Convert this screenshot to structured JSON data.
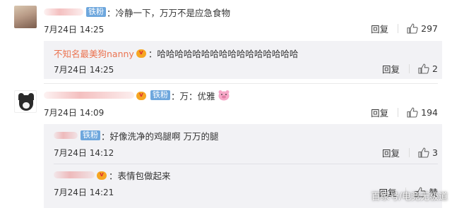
{
  "comments": [
    {
      "badge": "铁粉",
      "text": "冷静一下，万万不是应急食物",
      "time": "7月24日 14:25",
      "reply_label": "回复",
      "likes": "297",
      "replies": [
        {
          "username": "不知名最美狗nanny",
          "text": "哈哈哈哈哈哈哈哈哈哈哈哈哈哈哈哈",
          "time": "7月24日 14:25",
          "reply_label": "回复",
          "likes": "2"
        }
      ]
    },
    {
      "badge": "铁粉",
      "text": "万：优雅",
      "time": "7月24日 14:09",
      "reply_label": "回复",
      "likes": "194",
      "replies": [
        {
          "badge": "铁粉",
          "text": "好像洗净的鸡腿啊 万万的腿",
          "time": "7月24日 14:12",
          "reply_label": "回复",
          "likes": "3"
        },
        {
          "text": "表情包做起来",
          "time": "7月24日 14:21",
          "reply_label": "回复",
          "likes": "赞"
        }
      ]
    }
  ],
  "watermark": "百家号/电竞无极道",
  "colors": {
    "link": "#eb7350",
    "badge": "#6ea7dd",
    "sub_bg": "#f2f2f5"
  }
}
